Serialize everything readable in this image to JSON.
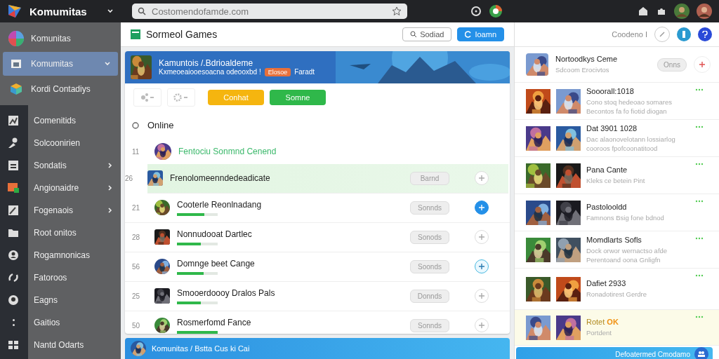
{
  "topbar": {
    "app_name": "Komumitas",
    "search": {
      "placeholder": "Costomendofamde.com"
    }
  },
  "sidebar": {
    "top_items": [
      {
        "label": "Komunitas",
        "selected": false,
        "expandable": false
      },
      {
        "label": "Komumitas",
        "selected": true,
        "expandable": true
      },
      {
        "label": "Kordi Contadiys",
        "selected": false,
        "expandable": false
      }
    ],
    "items": [
      {
        "label": "Comenitids",
        "selected": false,
        "expandable": false
      },
      {
        "label": "Solcoonirien",
        "selected": false,
        "expandable": false
      },
      {
        "label": "Sondatis",
        "selected": false,
        "expandable": true
      },
      {
        "label": "Angionaidre",
        "selected": false,
        "expandable": true
      },
      {
        "label": "Fogenaois",
        "selected": false,
        "expandable": true
      },
      {
        "label": "Root onitos",
        "selected": false,
        "expandable": false
      },
      {
        "label": "Rogamnonicas",
        "selected": false,
        "expandable": false
      },
      {
        "label": "Fatoroos",
        "selected": false,
        "expandable": false
      },
      {
        "label": "Eagns",
        "selected": false,
        "expandable": false
      },
      {
        "label": "Gaitios",
        "selected": false,
        "expandable": false
      },
      {
        "label": "Nantd Odarts",
        "selected": false,
        "expandable": false
      }
    ]
  },
  "main": {
    "title": "Sormeol Games",
    "buttons": [
      {
        "label": "Sodiad",
        "kind": "outline"
      },
      {
        "label": "Ioamn",
        "kind": "primary"
      }
    ],
    "banner": {
      "title": "Kamuntois /.Bdrioaldeme",
      "subtitle": "Kxmeoeaiooesoacna odeooxbd !",
      "badge": "Elosoe",
      "after": "Faradt"
    },
    "actions": [
      {
        "label": "Conhat",
        "kind": "warning"
      },
      {
        "label": "Somne",
        "kind": "success"
      }
    ],
    "section": "Online",
    "rows": [
      {
        "number": "11",
        "name": "Fentociu Sonmnd Cenend",
        "kind": "featured",
        "selected": false
      },
      {
        "number": "26",
        "name": "Frenolomeenndedeadicate",
        "kind": "entry",
        "selected": true,
        "button": "Barnd",
        "action": {
          "kind": "plain"
        }
      },
      {
        "number": "21",
        "name": "Cooterle Reonlnadang",
        "kind": "entry",
        "selected": false,
        "level": 0.68,
        "button": "Sonnds",
        "action": {
          "kind": "filled"
        }
      },
      {
        "number": "28",
        "name": "Nonnudooat Dartlec",
        "kind": "entry",
        "selected": false,
        "level": 0.58,
        "button": "Sonods",
        "action": {
          "kind": "plain"
        }
      },
      {
        "number": "56",
        "name": "Domnge beet Cange",
        "kind": "entry",
        "selected": false,
        "level": 0.66,
        "button": "Soonds",
        "action": {
          "kind": "outline"
        }
      },
      {
        "number": "25",
        "name": "Smooerdoooy Dralos Pals",
        "kind": "entry",
        "selected": false,
        "level": 0.59,
        "button": "Donnds",
        "action": {
          "kind": "plain"
        }
      },
      {
        "number": "50",
        "name": "Rosmerfomd Fance",
        "kind": "entry",
        "selected": false,
        "level": 1,
        "button": "Sonnds",
        "action": {
          "kind": "plain"
        }
      }
    ],
    "footer": "Komunitas / Bstta Cus ki Cai"
  },
  "right": {
    "title": "Coodeno I",
    "featured": {
      "title": "Nortoodkys Ceme",
      "subtitle": "Sdcoom Erocivtos",
      "button": "Onns"
    },
    "items": [
      {
        "title": "Sooorall:1018",
        "text": "Cono stoq hedeoao somares Becontos fa fo fiotid diogan",
        "selected": false
      },
      {
        "title": "Dat 3901 1028",
        "text": "Dac alaonovelotann lossiarlog cooroos fpofcoonatitood",
        "selected": false
      },
      {
        "title": "Pana Cante",
        "text": "Kleks ce betein Pint",
        "selected": false
      },
      {
        "title": "Pastolooldd",
        "text": "Famnons Bsig fone bdnod",
        "selected": false
      },
      {
        "title": "Momdlarts Sofls",
        "text": "Dock orwor wernactso afde Perentoand oona Gnligfn",
        "selected": false
      },
      {
        "title": "Dafiet 2933",
        "text": "Ronadotirest Gerdre",
        "selected": false
      },
      {
        "title": "Rotet",
        "tag": "OK",
        "text": "Portdent",
        "selected": true
      }
    ],
    "footer": "Defoatermed Cmodamo"
  }
}
